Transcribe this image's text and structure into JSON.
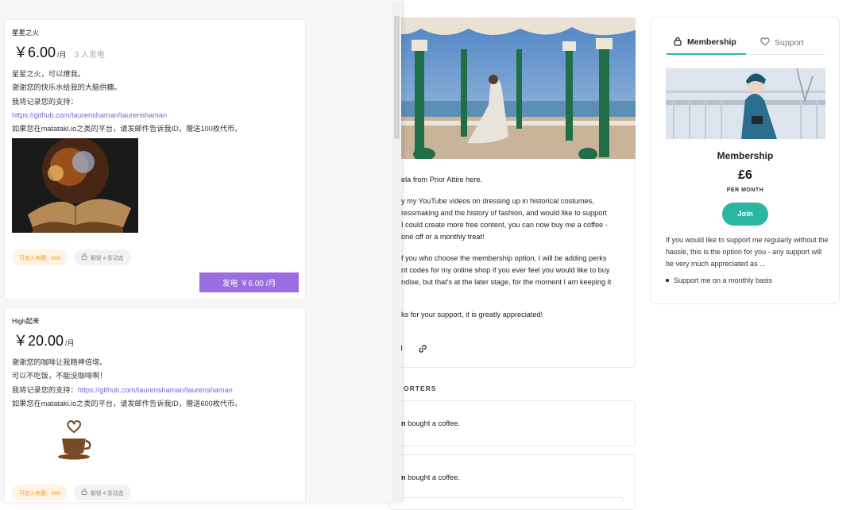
{
  "bg": {
    "about": {
      "line1": "ela from Prior Attire here.",
      "line2": "y my YouTube videos on dressing up in historical costumes,",
      "line3": "ressmaking and the history of fashion, and would like to support",
      "line4": "I could create more free content, you can now buy me a coffee -",
      "line5": "one off or a monthly treat!",
      "line6": "f you who choose the membership option,  I will be adding perks",
      "line7": "nt codes for my online shop if you ever feel you would like to buy",
      "line8": "ndise, but that's at the later stage, for the moment I am keeping it",
      "line9": "ks for your support, it is greatly appreciated!"
    },
    "supporters_title": "ORTERS",
    "supporters": [
      {
        "name": "n",
        "text": " bought a coffee."
      },
      {
        "name": "n",
        "text": " bought a coffee."
      }
    ],
    "membership": {
      "tab_active": "Membership",
      "tab_inactive": "Support",
      "name": "Membership",
      "price": "£6",
      "per": "PER MONTH",
      "join": "Join",
      "desc": " If you would like to support me  regularly without the hassle, this is the option for you - any support will be very much appreciated as ...",
      "perk": "Support me on a monthly basis",
      "accent": "#2ab7a1"
    }
  },
  "panel": {
    "tiers": [
      {
        "name": "星星之火",
        "price": "￥6.00",
        "unit": "/月",
        "backers": "3 人发电",
        "desc1": "星星之火，可以燎我。",
        "desc2": "谢谢您的快乐水给我的大脑供糖。",
        "desc3": "我将记录您的支持：",
        "link": "https://github.com/taurenshaman/taurenshaman",
        "desc4": "如果您在matataki.io之类的平台，请发邮件告诉我ID，赠送100枚代币。",
        "chip1": "可加入电圈：666",
        "chip2": "解锁 4 条动态",
        "button": "发电  ￥6.00 /月"
      },
      {
        "name": "High起来",
        "price": "￥20.00",
        "unit": "/月",
        "desc1": "谢谢您的咖啡让我精神倍增。",
        "desc2": "可以不吃饭，不能没咖啡啊！",
        "desc3": "我将记录您的支持：",
        "link": "https://github.com/taurenshaman/taurenshaman",
        "desc4": "如果您在matataki.io之类的平台，请发邮件告诉我ID，赠送600枚代币。",
        "chip1": "可加入电圈：666",
        "chip2": "解锁 4 条动态"
      }
    ],
    "accent": "#9a6de0"
  }
}
